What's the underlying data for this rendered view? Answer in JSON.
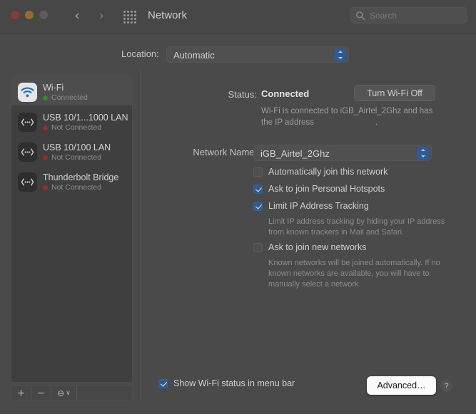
{
  "window": {
    "title": "Network",
    "traffic_lights": [
      {
        "name": "close",
        "color": "#8c3a35"
      },
      {
        "name": "minimize",
        "color": "#8e7027"
      },
      {
        "name": "zoom",
        "color": "#5c5c5c"
      }
    ],
    "nav": {
      "back": "‹",
      "forward": "›"
    },
    "grid_icon": "apps-grid-icon"
  },
  "search": {
    "placeholder": "Search",
    "icon": "search-icon"
  },
  "location": {
    "label": "Location:",
    "value": "Automatic",
    "options": [
      "Automatic"
    ]
  },
  "sidebar": {
    "services": [
      {
        "name": "Wi-Fi",
        "status": "Connected",
        "connected": true,
        "selected": true,
        "icon": "wifi-icon"
      },
      {
        "name": "USB 10/1...1000 LAN",
        "status": "Not Connected",
        "connected": false,
        "selected": false,
        "icon": "ethernet-icon"
      },
      {
        "name": "USB 10/100 LAN",
        "status": "Not Connected",
        "connected": false,
        "selected": false,
        "icon": "ethernet-icon"
      },
      {
        "name": "Thunderbolt Bridge",
        "status": "Not Connected",
        "connected": false,
        "selected": false,
        "icon": "ethernet-icon"
      }
    ],
    "footer": {
      "add": "+",
      "remove": "−",
      "action": "⊖",
      "action_chevron": "∨"
    }
  },
  "main": {
    "status_label": "Status:",
    "status_value": "Connected",
    "turn_wifi_off_label": "Turn Wi-Fi Off",
    "status_description_part1": "Wi-Fi is connected to iGB_Airtel_2Ghz and has the IP address",
    "status_description_part2": ".",
    "network_name_label": "Network Name:",
    "network_name_value": "iGB_Airtel_2Ghz",
    "checkboxes": [
      {
        "label": "Automatically join this network",
        "checked": false
      },
      {
        "label": "Ask to join Personal Hotspots",
        "checked": true
      },
      {
        "label": "Limit IP Address Tracking",
        "checked": true
      },
      {
        "label": "Ask to join new networks",
        "checked": false
      }
    ],
    "help_limit_ip": "Limit IP address tracking by hiding your IP address from known trackers in Mail and Safari.",
    "help_ask_join": "Known networks will be joined automatically. If no known networks are available, you will have to manually select a network."
  },
  "bottom": {
    "show_status_label": "Show Wi-Fi status in menu bar",
    "show_status_checked": true,
    "advanced_label": "Advanced…",
    "help_label": "?"
  },
  "colors": {
    "accent_blue": "#2f5c90",
    "connected_green": "#2a8d2a",
    "disconnected_red": "#9e2a28",
    "window_bg": "#4a4a4a",
    "highlight_button": "#fbfbfb"
  }
}
